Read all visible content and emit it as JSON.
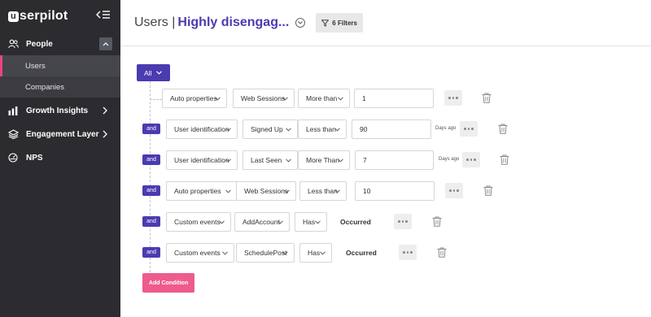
{
  "app": {
    "logo_text": "serpilot",
    "logo_letter": "u"
  },
  "sidebar": {
    "people": {
      "label": "People"
    },
    "sub_items": [
      {
        "label": "Users",
        "active": true
      },
      {
        "label": "Companies",
        "active": false
      }
    ],
    "items": [
      {
        "label": "Growth Insights"
      },
      {
        "label": "Engagement Layer"
      },
      {
        "label": "NPS"
      }
    ]
  },
  "header": {
    "title_prefix": "Users |",
    "title_segment": "Highly disengag...",
    "filters_label": "6 Filters"
  },
  "filter_builder": {
    "all_label": "All",
    "and_label": "and",
    "rows": [
      {
        "property_type": "Auto properties",
        "property": "Web Sessions",
        "operator": "More than",
        "value": "1",
        "unit": ""
      },
      {
        "property_type": "User identification",
        "property": "Signed Up",
        "operator": "Less than",
        "value": "90",
        "unit": "Days ago"
      },
      {
        "property_type": "User identification",
        "property": "Last Seen",
        "operator": "More Than",
        "value": "7",
        "unit": "Days ago"
      },
      {
        "property_type": "Auto properties",
        "property": "Web Sessions",
        "operator": "Less than",
        "value": "10",
        "unit": ""
      },
      {
        "property_type": "Custom events",
        "property": "AddAccount",
        "operator": "Has",
        "value": "Occurred",
        "unit": ""
      },
      {
        "property_type": "Custom events",
        "property": "SchedulePost",
        "operator": "Has",
        "value": "Occurred",
        "unit": ""
      }
    ],
    "add_condition_label": "Add Condition"
  },
  "colors": {
    "sidebar_bg": "#2b2b30",
    "accent": "#4b3bb0",
    "pink": "#ee5b8d",
    "active_marker": "#e8487c"
  }
}
